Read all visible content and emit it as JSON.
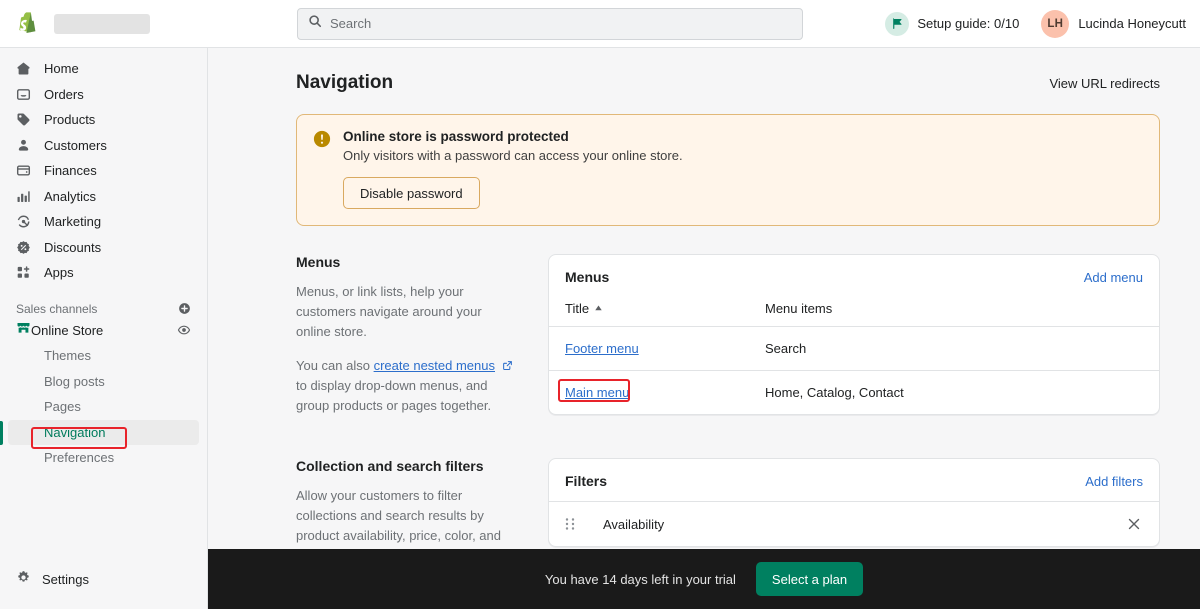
{
  "topbar": {
    "logo_icon": "shopify-bag-icon",
    "store_name_redacted": "",
    "search": {
      "placeholder": "Search",
      "value": "",
      "icon": "search-icon"
    },
    "setup_guide": {
      "label": "Setup guide: 0/10",
      "icon": "flag-icon"
    },
    "user": {
      "initials": "LH",
      "name": "Lucinda Honeycutt"
    }
  },
  "sidebar": {
    "items": [
      {
        "label": "Home",
        "icon": "home-icon"
      },
      {
        "label": "Orders",
        "icon": "orders-icon"
      },
      {
        "label": "Products",
        "icon": "tag-icon"
      },
      {
        "label": "Customers",
        "icon": "person-icon"
      },
      {
        "label": "Finances",
        "icon": "wallet-icon"
      },
      {
        "label": "Analytics",
        "icon": "bar-chart-icon"
      },
      {
        "label": "Marketing",
        "icon": "megaphone-icon"
      },
      {
        "label": "Discounts",
        "icon": "discount-icon"
      },
      {
        "label": "Apps",
        "icon": "apps-grid-icon"
      }
    ],
    "sales_channels": {
      "label": "Sales channels",
      "add_icon": "plus-circle-icon"
    },
    "online_store": {
      "label": "Online Store",
      "icon": "storefront-icon",
      "view_icon": "eye-icon"
    },
    "sub_items": [
      {
        "label": "Themes",
        "active": false
      },
      {
        "label": "Blog posts",
        "active": false
      },
      {
        "label": "Pages",
        "active": false
      },
      {
        "label": "Navigation",
        "active": true
      },
      {
        "label": "Preferences",
        "active": false
      }
    ],
    "settings": {
      "label": "Settings",
      "icon": "gear-icon"
    }
  },
  "page": {
    "title": "Navigation",
    "header_action": "View URL redirects"
  },
  "banner": {
    "icon": "alert-circle-icon",
    "title": "Online store is password protected",
    "text": "Only visitors with a password can access your online store.",
    "button": "Disable password"
  },
  "menus_section": {
    "aside_title": "Menus",
    "aside_desc_1": "Menus, or link lists, help your customers navigate around your online store.",
    "aside_desc_2_pre": "You can also ",
    "aside_desc_2_link": "create nested menus",
    "aside_link_icon": "external-link-icon",
    "aside_desc_2_post": " to display drop-down menus, and group products or pages together.",
    "card_title": "Menus",
    "card_action": "Add menu",
    "columns": {
      "title": "Title",
      "sort_icon": "sort-ascending-icon",
      "items": "Menu items"
    },
    "rows": [
      {
        "title": "Footer menu",
        "items": "Search",
        "highlighted": false
      },
      {
        "title": "Main menu",
        "items": "Home, Catalog, Contact",
        "highlighted": true
      }
    ]
  },
  "filters_section": {
    "aside_title": "Collection and search filters",
    "aside_desc": "Allow your customers to filter collections and search results by product availability, price, color, and more.",
    "card_title": "Filters",
    "card_action": "Add filters",
    "rows": [
      {
        "name": "Availability",
        "drag_icon": "drag-handle-icon",
        "remove_icon": "close-icon"
      }
    ]
  },
  "trial_bar": {
    "text": "You have 14 days left in your trial",
    "button": "Select a plan"
  },
  "colors": {
    "brand_green": "#008060",
    "link_blue": "#2c6ecb",
    "warning_border": "#e1b878",
    "warning_bg": "#fff5ea",
    "annotation_red": "#e8232a",
    "avatar_bg": "#fbc1ac"
  }
}
